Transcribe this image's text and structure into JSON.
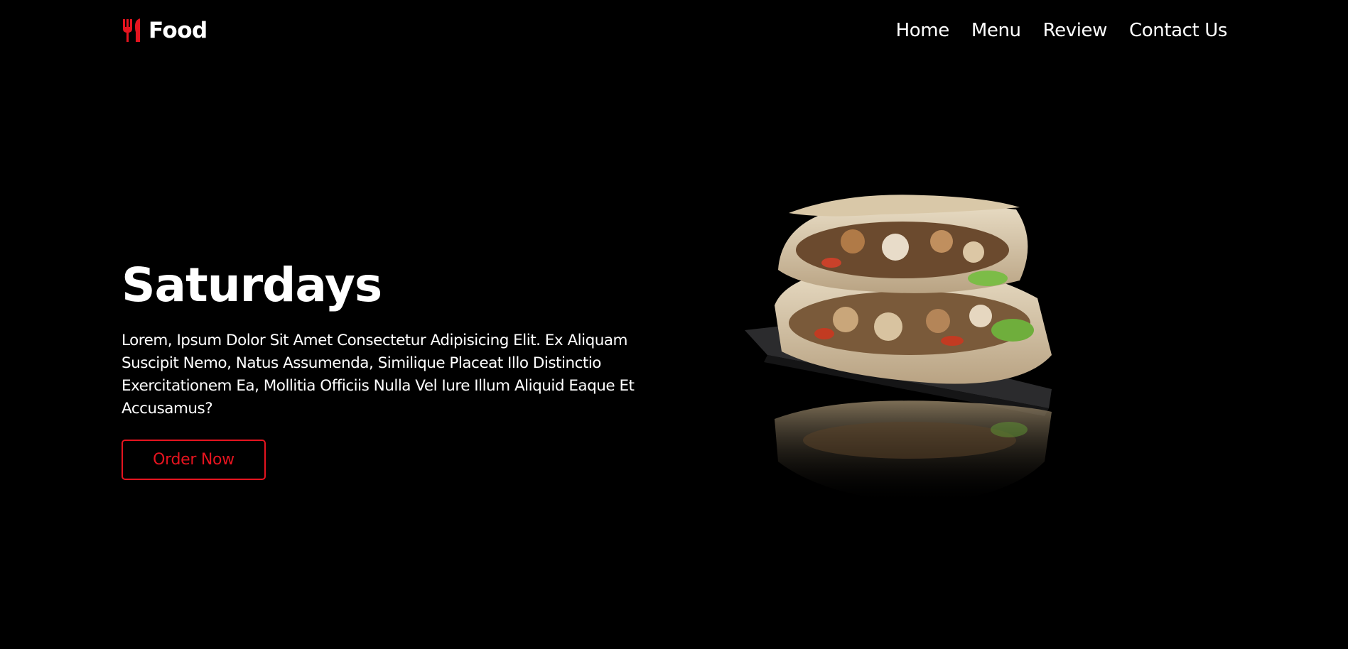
{
  "header": {
    "logo_text": "Food",
    "logo_icon": "fork-knife-icon",
    "nav": [
      {
        "label": "Home"
      },
      {
        "label": "Menu"
      },
      {
        "label": "Review"
      },
      {
        "label": "Contact Us"
      }
    ]
  },
  "hero": {
    "title": "Saturdays",
    "description": "Lorem, Ipsum Dolor Sit Amet Consectetur Adipisicing Elit. Ex Aliquam Suscipit Nemo, Natus Assumenda, Similique Placeat Illo Distinctio Exercitationem Ea, Mollitia Officiis Nulla Vel Iure Illum Aliquid Eaque Et Accusamus?",
    "button_label": "Order Now",
    "image_subject": "shawarma-wrap-image"
  },
  "colors": {
    "background": "#000000",
    "accent": "#e5141f",
    "text": "#ffffff"
  }
}
